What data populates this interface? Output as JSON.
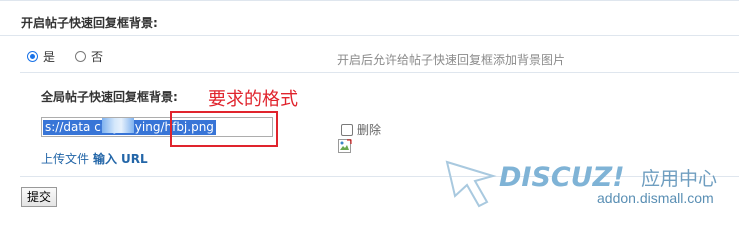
{
  "setting": {
    "title": "开启帖子快速回复框背景:",
    "options": [
      {
        "label": "是",
        "checked": true
      },
      {
        "label": "否",
        "checked": false
      }
    ],
    "tip": "开启后允许给帖子快速回复框添加背景图片"
  },
  "global_bg": {
    "title": "全局帖子快速回复框背景:",
    "annotation": "要求的格式",
    "input_value": "s://data            cn/yunying/hfbj.png",
    "delete_label": "删除",
    "upload_label": "上传文件",
    "input_label": "输入",
    "url_label": "URL"
  },
  "submit_label": "提交",
  "watermark": {
    "brand": "DISCUZ!",
    "app_center": "应用中心",
    "url": "addon.dismall.com"
  },
  "colors": {
    "annotation_red": "#e0242d",
    "selection_blue": "#3875d7",
    "link_blue": "#2366a8",
    "watermark_blue": "#7fb3d6"
  }
}
